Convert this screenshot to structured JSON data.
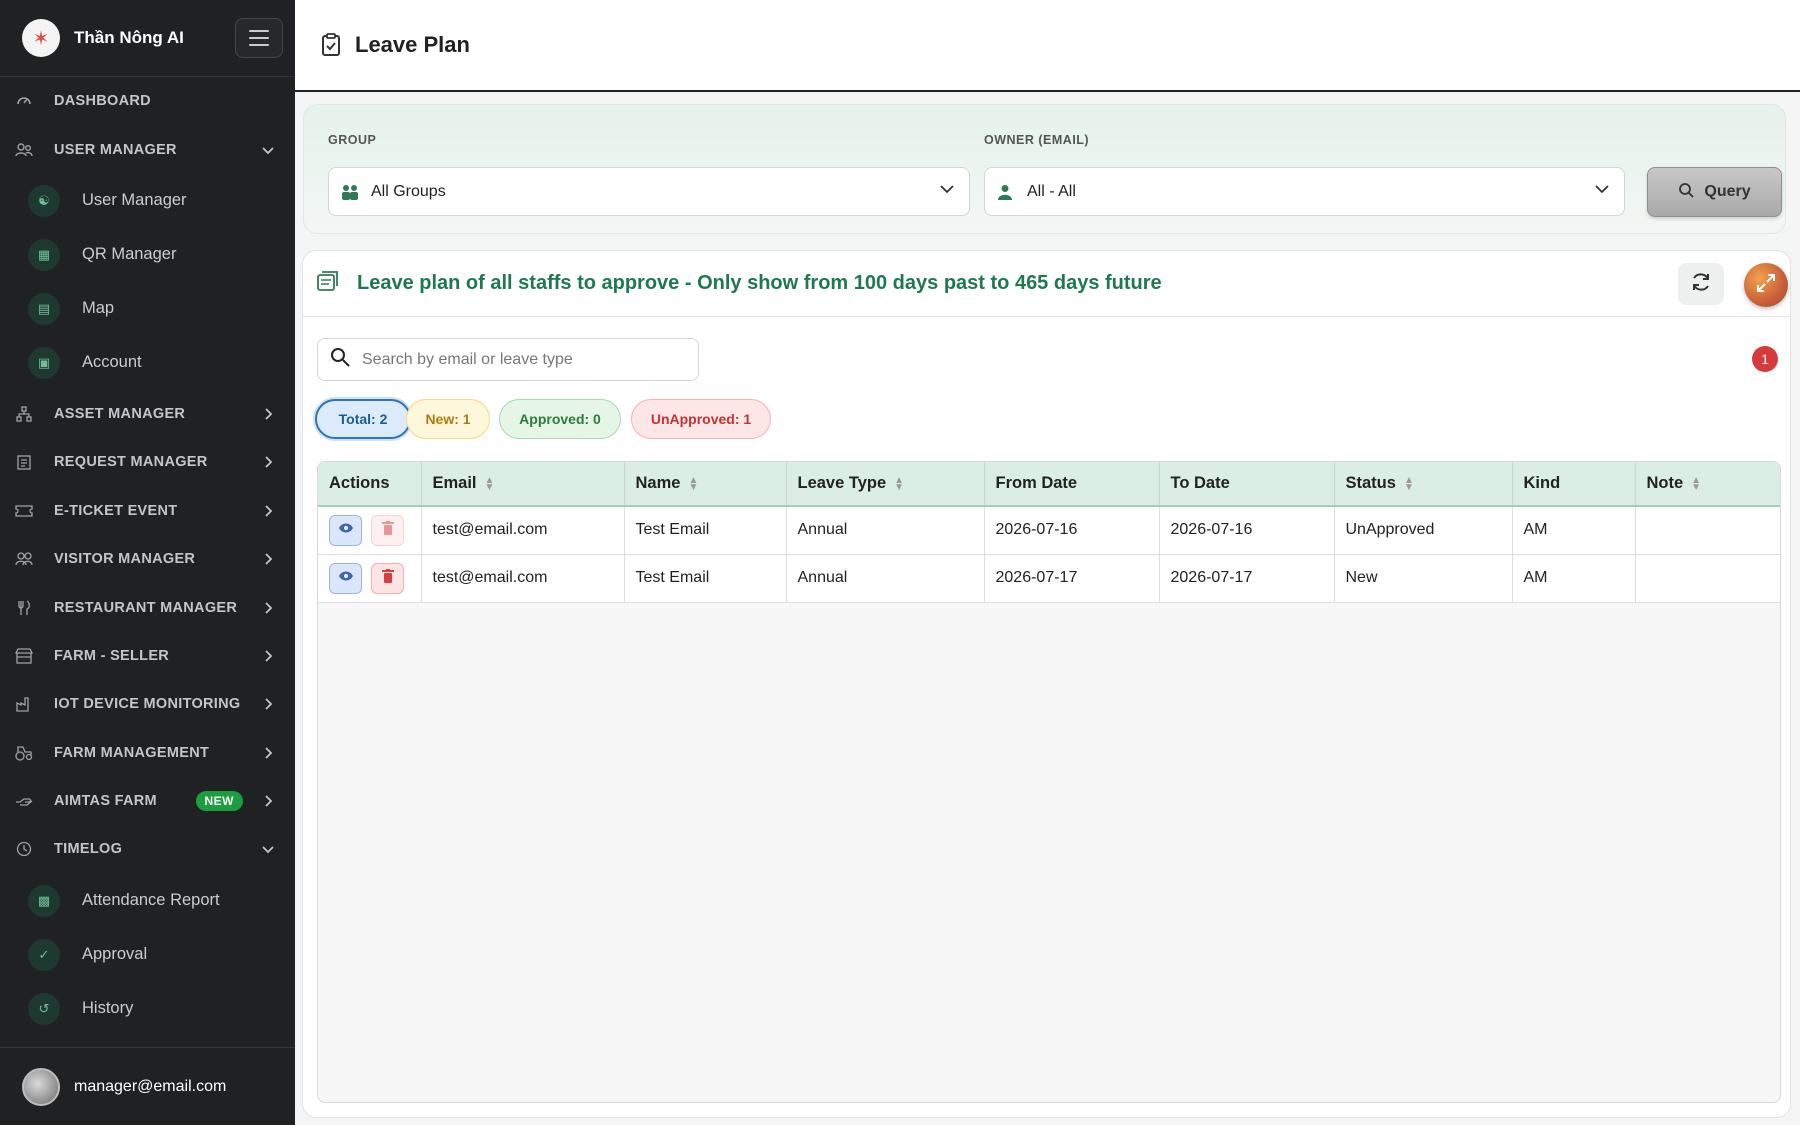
{
  "brand": {
    "name": "Thần Nông AI"
  },
  "sidebar": {
    "items": [
      {
        "label": "DASHBOARD",
        "icon": "gauge-icon"
      },
      {
        "label": "USER MANAGER",
        "icon": "users-icon",
        "expanded": true,
        "children": [
          {
            "label": "User Manager",
            "icon": "users-icon"
          },
          {
            "label": "QR Manager",
            "icon": "qr-code-icon"
          },
          {
            "label": "Map",
            "icon": "map-icon"
          },
          {
            "label": "Account",
            "icon": "id-card-icon"
          }
        ]
      },
      {
        "label": "ASSET MANAGER",
        "icon": "sitemap-icon"
      },
      {
        "label": "REQUEST MANAGER",
        "icon": "clipboard-icon"
      },
      {
        "label": "E-TICKET EVENT",
        "icon": "ticket-icon"
      },
      {
        "label": "VISITOR MANAGER",
        "icon": "visitors-icon"
      },
      {
        "label": "RESTAURANT MANAGER",
        "icon": "utensils-icon"
      },
      {
        "label": "FARM - SELLER",
        "icon": "store-icon"
      },
      {
        "label": "IOT DEVICE MONITORING",
        "icon": "industry-icon"
      },
      {
        "label": "FARM MANAGEMENT",
        "icon": "tractor-icon"
      },
      {
        "label": "AIMTAS FARM",
        "icon": "hand-icon",
        "badge": "NEW"
      },
      {
        "label": "TIMELOG",
        "icon": "clock-icon",
        "expanded": true,
        "children": [
          {
            "label": "Attendance Report",
            "icon": "bar-chart-icon"
          },
          {
            "label": "Approval",
            "icon": "thumbs-up-icon"
          },
          {
            "label": "History",
            "icon": "history-icon"
          }
        ]
      }
    ],
    "footer_email": "manager@email.com"
  },
  "header": {
    "title": "Leave Plan"
  },
  "filters": {
    "group_label": "GROUP",
    "group_value": "All Groups",
    "owner_label": "OWNER (EMAIL)",
    "owner_value": "All - All",
    "query_label": "Query"
  },
  "panel": {
    "title": "Leave plan of all staffs to approve - Only show from 100 days past to 465 days future",
    "search_placeholder": "Search by email or leave type",
    "notification_count": "1"
  },
  "chips": {
    "total": "Total: 2",
    "new": "New: 1",
    "approved": "Approved: 0",
    "unapproved": "UnApproved: 1"
  },
  "table": {
    "columns": [
      "Actions",
      "Email",
      "Name",
      "Leave Type",
      "From Date",
      "To Date",
      "Status",
      "Kind",
      "Note"
    ],
    "rows": [
      {
        "email": "test@email.com",
        "name": "Test Email",
        "leave_type": "Annual",
        "from_date": "2026-07-16",
        "to_date": "2026-07-16",
        "status": "UnApproved",
        "kind": "AM",
        "note": ""
      },
      {
        "email": "test@email.com",
        "name": "Test Email",
        "leave_type": "Annual",
        "from_date": "2026-07-17",
        "to_date": "2026-07-17",
        "status": "New",
        "kind": "AM",
        "note": ""
      }
    ]
  },
  "colors": {
    "sidebar_bg": "#1f2123",
    "accent_green": "#1e7a4e",
    "new_badge": "#1a9e3e",
    "danger": "#d73a3a"
  }
}
